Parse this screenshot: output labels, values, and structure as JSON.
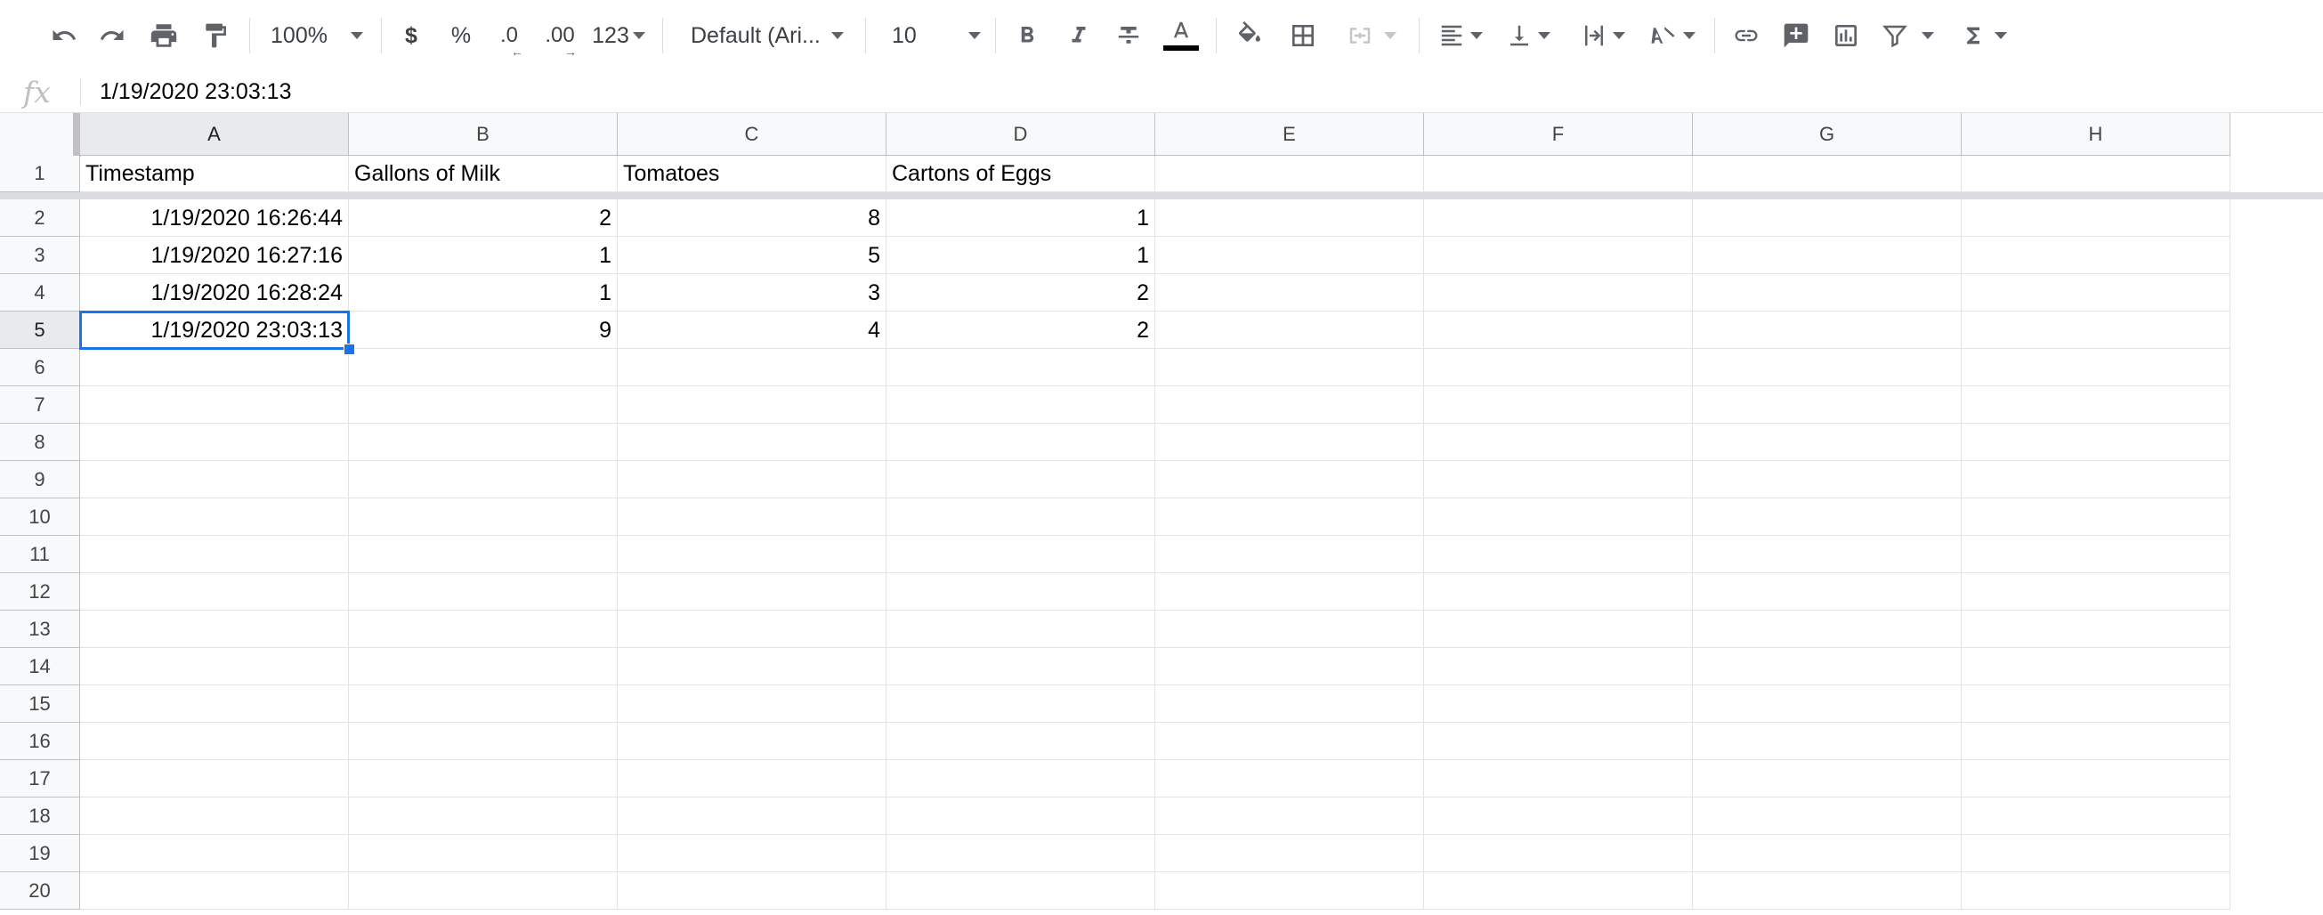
{
  "toolbar": {
    "zoom": "100%",
    "currency": "$",
    "percent": "%",
    "dec_decrease": ".0",
    "dec_increase": ".00",
    "more_formats": "123",
    "font": "Default (Ari...",
    "font_size": "10",
    "text_color_accent": "#000000",
    "icons": [
      "undo-icon",
      "redo-icon",
      "print-icon",
      "paint-format-icon",
      "bold-icon",
      "italic-icon",
      "strikethrough-icon",
      "text-color-icon",
      "fill-color-icon",
      "borders-icon",
      "merge-cells-icon",
      "horizontal-align-icon",
      "vertical-align-icon",
      "text-wrap-icon",
      "text-rotation-icon",
      "link-icon",
      "comment-icon",
      "chart-icon",
      "filter-icon",
      "functions-icon"
    ]
  },
  "formula_bar": {
    "fx": "fx",
    "value": "1/19/2020 23:03:13"
  },
  "sheet": {
    "columns": [
      "A",
      "B",
      "C",
      "D",
      "E",
      "F",
      "G",
      "H"
    ],
    "rows": [
      "1",
      "2",
      "3",
      "4",
      "5",
      "6",
      "7",
      "8",
      "9",
      "10",
      "11",
      "12",
      "13",
      "14",
      "15",
      "16",
      "17",
      "18",
      "19",
      "20"
    ],
    "header_row": [
      "Timestamp",
      "Gallons of Milk",
      "Tomatoes",
      "Cartons of Eggs"
    ],
    "data": [
      [
        "1/19/2020 16:26:44",
        "2",
        "8",
        "1"
      ],
      [
        "1/19/2020 16:27:16",
        "1",
        "5",
        "1"
      ],
      [
        "1/19/2020 16:28:24",
        "1",
        "3",
        "2"
      ],
      [
        "1/19/2020 23:03:13",
        "9",
        "4",
        "2"
      ]
    ],
    "selected_cell": "A5",
    "selection_color": "#1a73e8"
  }
}
